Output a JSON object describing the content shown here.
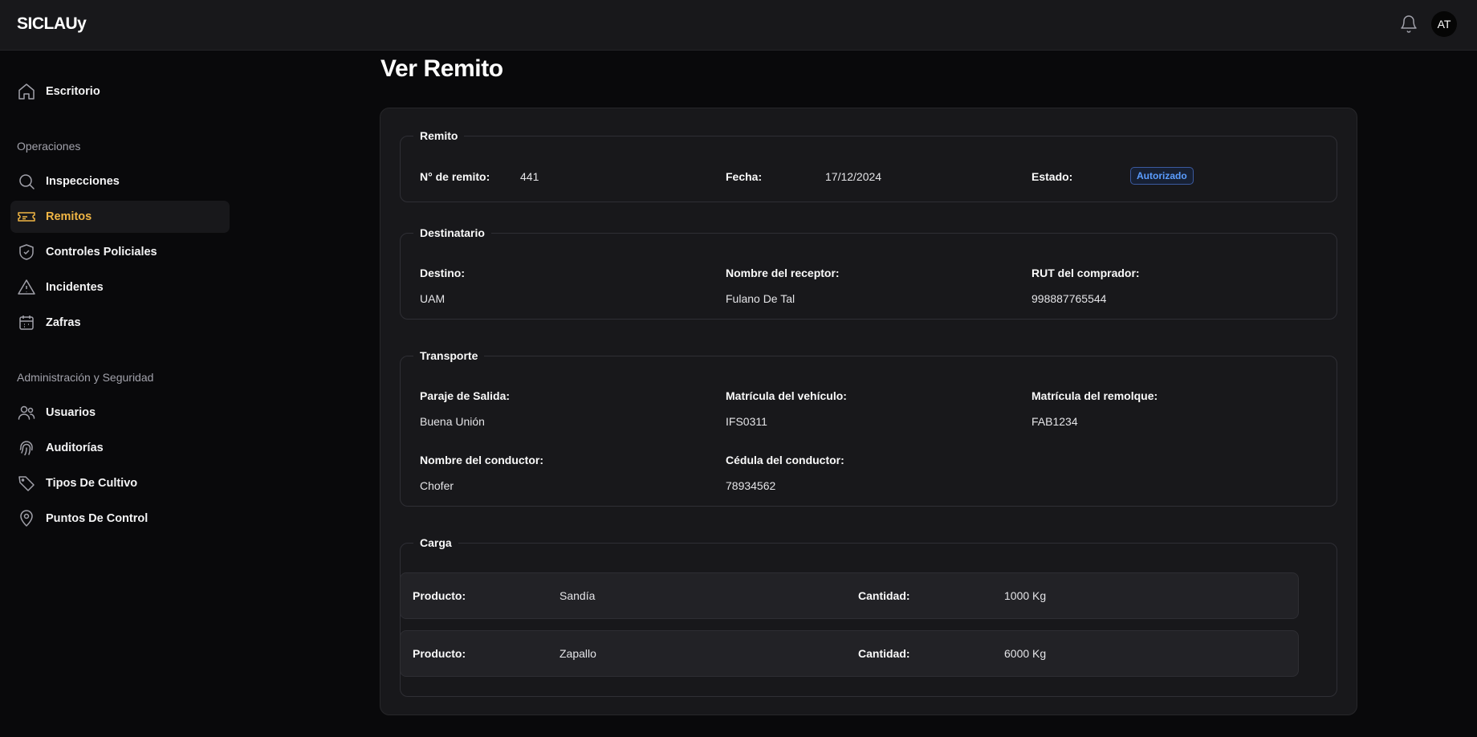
{
  "app": {
    "brand": "SICLAUy",
    "avatar_initials": "AT"
  },
  "sidebar": {
    "top_item": {
      "label": "Escritorio",
      "icon": "home-icon"
    },
    "sections": [
      {
        "title": "Operaciones"
      },
      {
        "title": "Administración y Seguridad"
      }
    ],
    "items": [
      {
        "label": "Inspecciones",
        "icon": "search-icon"
      },
      {
        "label": "Remitos",
        "icon": "ticket-icon",
        "active": true
      },
      {
        "label": "Controles Policiales",
        "icon": "shield-icon"
      },
      {
        "label": "Incidentes",
        "icon": "warning-icon"
      },
      {
        "label": "Zafras",
        "icon": "calendar-icon"
      },
      {
        "label": "Usuarios",
        "icon": "users-icon"
      },
      {
        "label": "Auditorías",
        "icon": "fingerprint-icon"
      },
      {
        "label": "Tipos De Cultivo",
        "icon": "tag-icon"
      },
      {
        "label": "Puntos De Control",
        "icon": "map-pin-icon"
      }
    ]
  },
  "page": {
    "title": "Ver Remito"
  },
  "remito": {
    "legend": "Remito",
    "numero_label": "N° de remito:",
    "numero": "441",
    "fecha_label": "Fecha:",
    "fecha": "17/12/2024",
    "estado_label": "Estado:",
    "estado": "Autorizado"
  },
  "destinatario": {
    "legend": "Destinatario",
    "destino_label": "Destino:",
    "destino": "UAM",
    "receptor_label": "Nombre del receptor:",
    "receptor": "Fulano De Tal",
    "rut_label": "RUT del comprador:",
    "rut": "998887765544"
  },
  "transporte": {
    "legend": "Transporte",
    "paraje_label": "Paraje de Salida:",
    "paraje": "Buena Unión",
    "matricula_vehiculo_label": "Matrícula del vehículo:",
    "matricula_vehiculo": "IFS0311",
    "matricula_remolque_label": "Matrícula del remolque:",
    "matricula_remolque": "FAB1234",
    "conductor_label": "Nombre del conductor:",
    "conductor": "Chofer",
    "cedula_label": "Cédula del conductor:",
    "cedula": "78934562"
  },
  "carga": {
    "legend": "Carga",
    "items": [
      {
        "producto_label": "Producto:",
        "producto": "Sandía",
        "cantidad_label": "Cantidad:",
        "cantidad": "1000 Kg"
      },
      {
        "producto_label": "Producto:",
        "producto": "Zapallo",
        "cantidad_label": "Cantidad:",
        "cantidad": "6000 Kg"
      }
    ]
  },
  "colors": {
    "accent": "#f0b544",
    "badge_text": "#5b9dff",
    "background": "#09090b",
    "surface": "#18181b"
  }
}
